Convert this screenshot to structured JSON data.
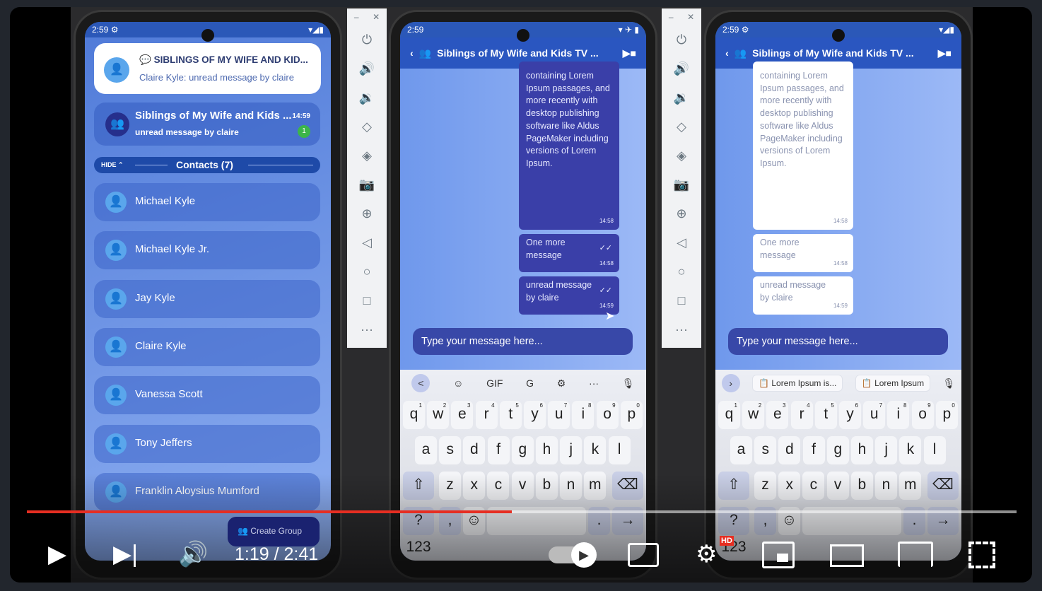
{
  "phone1": {
    "status": {
      "time": "2:59",
      "left_icon": "gear-icon",
      "right": "▾◢▮"
    },
    "notification": {
      "title": "SIBLINGS OF MY WIFE AND KID...",
      "body": "Claire Kyle: unread message by claire",
      "icon": "chat-bubble-icon"
    },
    "chat_item": {
      "title": "Siblings of My Wife and Kids ...",
      "time": "14:59",
      "preview": "unread message by claire",
      "badge": "1"
    },
    "contacts_header": {
      "hide": "HIDE",
      "title": "Contacts (7)"
    },
    "contacts": [
      "Michael Kyle",
      "Michael Kyle Jr.",
      "Jay Kyle",
      "Claire Kyle",
      "Vanessa Scott",
      "Tony Jeffers",
      "Franklin Aloysius Mumford"
    ],
    "create_group": "Create Group"
  },
  "phone2": {
    "status": {
      "time": "2:59",
      "right": "▾ ✈ ▮"
    },
    "header_title": "Siblings of My Wife and Kids TV ...",
    "messages": [
      {
        "text": "containing Lorem Ipsum passages, and more recently with desktop publishing software like Aldus PageMaker including versions of Lorem Ipsum.",
        "time": "14:58"
      },
      {
        "text": "One more message",
        "time": "14:58",
        "status": "✓✓"
      },
      {
        "text": "unread message by claire",
        "time": "14:59",
        "status": "✓✓"
      }
    ],
    "input_placeholder": "Type your message here...",
    "kb_bar": [
      "<",
      "☺",
      "GIF",
      "G",
      "⚙",
      "···",
      "🎙"
    ]
  },
  "phone3": {
    "status": {
      "time": "2:59",
      "right": "▾◢▮"
    },
    "header_title": "Siblings of My Wife and Kids TV ...",
    "messages": [
      {
        "text": "containing Lorem Ipsum passages, and more recently with desktop publishing software like Aldus PageMaker including versions of Lorem Ipsum.",
        "time": "14:58"
      },
      {
        "text": "One more message",
        "time": "14:58"
      },
      {
        "text": "unread message by claire",
        "time": "14:59"
      }
    ],
    "input_placeholder": "Type your message here...",
    "clip_chips": [
      "Lorem Ipsum is...",
      "Lorem Ipsum"
    ]
  },
  "keyboard": {
    "row1": [
      "q",
      "w",
      "e",
      "r",
      "t",
      "y",
      "u",
      "i",
      "o",
      "p"
    ],
    "row1_hints": [
      "1",
      "2",
      "3",
      "4",
      "5",
      "6",
      "7",
      "8",
      "9",
      "0"
    ],
    "row2": [
      "a",
      "s",
      "d",
      "f",
      "g",
      "h",
      "j",
      "k",
      "l"
    ],
    "row3": [
      "z",
      "x",
      "c",
      "v",
      "b",
      "n",
      "m"
    ],
    "symbols": "?123",
    "comma": ",",
    "period": "."
  },
  "emulator_toolbar": {
    "icons": [
      "power-icon",
      "volume-up-icon",
      "volume-down-icon",
      "rotate-left-icon",
      "rotate-right-icon",
      "camera-icon",
      "zoom-icon",
      "back-icon",
      "home-icon",
      "overview-icon",
      "more-icon"
    ]
  },
  "player": {
    "current_time": "1:19",
    "duration": "2:41",
    "time_display": "1:19 / 2:41",
    "progress_percent": 49,
    "quality_badge": "HD",
    "accent": "#e62e22"
  }
}
